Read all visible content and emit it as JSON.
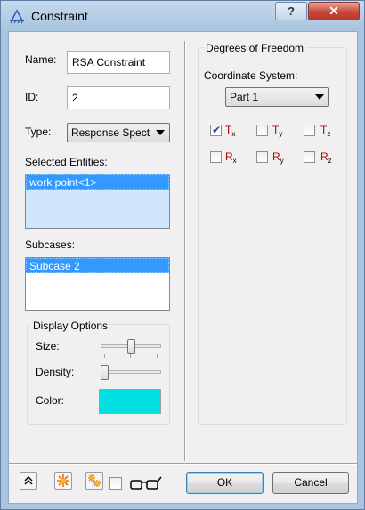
{
  "window": {
    "title": "Constraint",
    "help_label": "?",
    "close_label": "✕"
  },
  "left": {
    "name_label": "Name:",
    "name_value": "RSA Constraint",
    "id_label": "ID:",
    "id_value": "2",
    "type_label": "Type:",
    "type_value": "Response Spect",
    "selected_entities_label": "Selected Entities:",
    "selected_entities": [
      "work point<1>"
    ],
    "subcases_label": "Subcases:",
    "subcases": [
      "Subcase 2"
    ],
    "display_options": {
      "title": "Display Options",
      "size_label": "Size:",
      "size_level": 0.5,
      "density_label": "Density:",
      "density_level": 0.0,
      "color_label": "Color:",
      "color_value": "#00e0e0"
    }
  },
  "right": {
    "group_title": "Degrees of Freedom",
    "coord_label": "Coordinate System:",
    "coord_value": "Part 1",
    "dofs": [
      {
        "letter": "T",
        "sub": "x",
        "checked": true
      },
      {
        "letter": "T",
        "sub": "y",
        "checked": false
      },
      {
        "letter": "T",
        "sub": "z",
        "checked": false
      },
      {
        "letter": "R",
        "sub": "x",
        "checked": false
      },
      {
        "letter": "R",
        "sub": "y",
        "checked": false
      },
      {
        "letter": "R",
        "sub": "z",
        "checked": false
      }
    ]
  },
  "footer": {
    "ok_label": "OK",
    "cancel_label": "Cancel",
    "glasses_checked": false
  }
}
